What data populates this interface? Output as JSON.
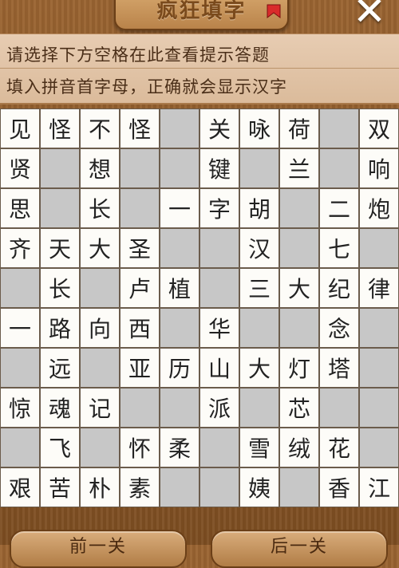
{
  "header": {
    "title": "疯狂填字",
    "close_label": "✕"
  },
  "hint": {
    "line1": "请选择下方空格在此查看提示答题",
    "line2": "填入拼音首字母，正确就会显示汉字"
  },
  "grid": {
    "rows": [
      [
        "见",
        "怪",
        "不",
        "怪",
        "",
        "关",
        "咏",
        "荷",
        "",
        "双"
      ],
      [
        "贤",
        "",
        "想",
        "",
        "",
        "键",
        "",
        "兰",
        "",
        "响"
      ],
      [
        "思",
        "",
        "长",
        "",
        "一",
        "字",
        "胡",
        "",
        "二",
        "炮"
      ],
      [
        "齐",
        "天",
        "大",
        "圣",
        "",
        "",
        "汉",
        "",
        "七",
        ""
      ],
      [
        "",
        "长",
        "",
        "卢",
        "植",
        "",
        "三",
        "大",
        "纪",
        "律"
      ],
      [
        "一",
        "路",
        "向",
        "西",
        "",
        "华",
        "",
        "",
        "念",
        ""
      ],
      [
        "",
        "远",
        "",
        "亚",
        "历",
        "山",
        "大",
        "灯",
        "塔",
        ""
      ],
      [
        "惊",
        "魂",
        "记",
        "",
        "",
        "派",
        "",
        "芯",
        "",
        ""
      ],
      [
        "",
        "飞",
        "",
        "怀",
        "柔",
        "",
        "雪",
        "绒",
        "花",
        ""
      ],
      [
        "艰",
        "苦",
        "朴",
        "素",
        "",
        "",
        "姨",
        "",
        "香",
        "江"
      ]
    ],
    "filled_cells": [
      [
        1,
        1,
        1,
        1,
        0,
        1,
        1,
        1,
        0,
        1
      ],
      [
        1,
        0,
        1,
        0,
        0,
        1,
        0,
        1,
        0,
        1
      ],
      [
        1,
        0,
        1,
        0,
        1,
        1,
        1,
        0,
        1,
        1
      ],
      [
        1,
        1,
        1,
        1,
        0,
        0,
        1,
        0,
        1,
        0
      ],
      [
        0,
        1,
        0,
        1,
        1,
        0,
        1,
        1,
        1,
        1
      ],
      [
        1,
        1,
        1,
        1,
        0,
        1,
        0,
        0,
        1,
        0
      ],
      [
        0,
        1,
        0,
        1,
        1,
        1,
        1,
        1,
        1,
        0
      ],
      [
        1,
        1,
        1,
        0,
        0,
        1,
        0,
        1,
        0,
        0
      ],
      [
        0,
        1,
        0,
        1,
        1,
        0,
        1,
        1,
        1,
        0
      ],
      [
        1,
        1,
        1,
        1,
        0,
        0,
        1,
        0,
        1,
        1
      ]
    ]
  },
  "nav": {
    "prev_label": "前一关",
    "next_label": "后一关"
  },
  "colors": {
    "wood": "#8a5a2c",
    "cell_letter": "#fdfcf8",
    "cell_blank": "#c7c7c7"
  }
}
